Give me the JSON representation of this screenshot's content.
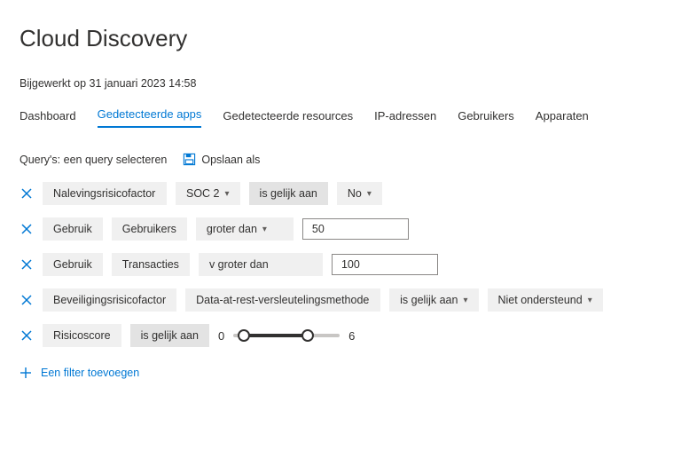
{
  "header": {
    "title": "Cloud Discovery"
  },
  "timestamp": "Bijgewerkt op 31 januari 2023 14:58",
  "tabs": [
    {
      "label": "Dashboard",
      "active": false
    },
    {
      "label": "Gedetecteerde apps",
      "active": true
    },
    {
      "label": "Gedetecteerde resources",
      "active": false
    },
    {
      "label": "IP-adressen",
      "active": false
    },
    {
      "label": "Gebruikers",
      "active": false
    },
    {
      "label": "Apparaten",
      "active": false
    }
  ],
  "query": {
    "label": "Query's: een query selecteren",
    "save_as": "Opslaan als"
  },
  "filters": {
    "r0": {
      "a": "Nalevingsrisicofactor",
      "b": "SOC 2",
      "op": "is gelijk aan",
      "val": "No"
    },
    "r1": {
      "a": "Gebruik",
      "b": "Gebruikers",
      "op": "groter dan",
      "val": "50"
    },
    "r2": {
      "a": "Gebruik",
      "b": "Transacties",
      "op": "v groter dan",
      "val": "100"
    },
    "r3": {
      "a": "Beveiligingsrisicofactor",
      "b": "Data-at-rest-versleutelingsmethode",
      "op": "is gelijk aan",
      "val": "Niet ondersteund"
    },
    "r4": {
      "a": "Risicoscore",
      "op": "is gelijk aan",
      "min": "0",
      "max": "6"
    }
  },
  "add_filter": "Een filter toevoegen"
}
